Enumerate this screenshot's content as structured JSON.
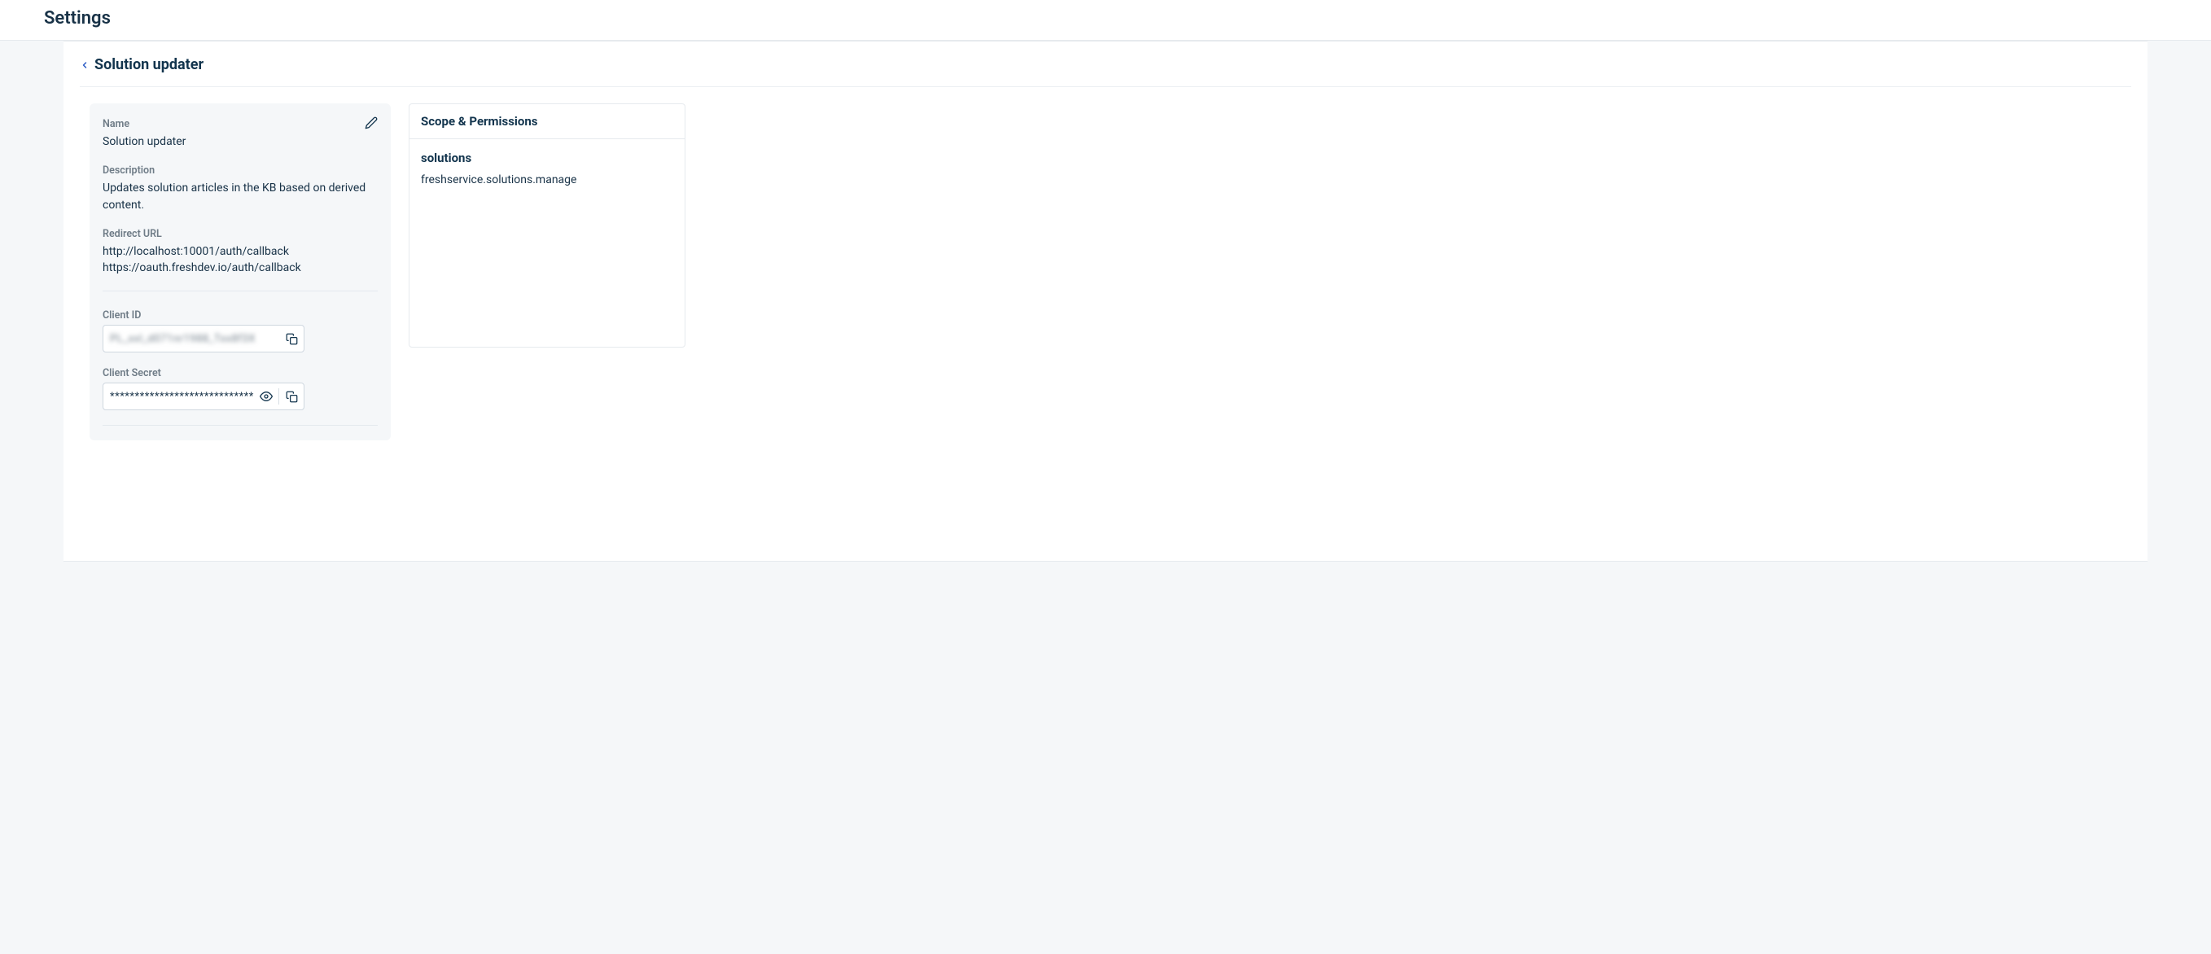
{
  "header": {
    "title": "Settings"
  },
  "breadcrumb": {
    "title": "Solution updater"
  },
  "details": {
    "name_label": "Name",
    "name_value": "Solution updater",
    "description_label": "Description",
    "description_value": "Updates solution articles in the KB based on derived content.",
    "redirect_label": "Redirect URL",
    "redirect_values": [
      "http://localhost:10001/auth/callback",
      "https://oauth.freshdev.io/auth/callback"
    ],
    "client_id_label": "Client ID",
    "client_id_value": "PL_xxl_d071nr1988_Txx8f3X",
    "client_secret_label": "Client Secret",
    "client_secret_value": "*******************************"
  },
  "permissions": {
    "panel_title": "Scope & Permissions",
    "group": "solutions",
    "scope": "freshservice.solutions.manage"
  }
}
